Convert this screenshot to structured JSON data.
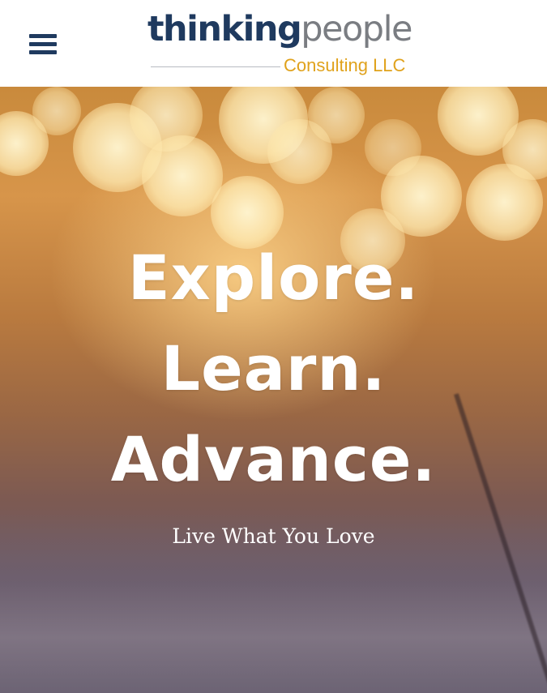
{
  "header": {
    "menu_icon": "hamburger-menu-icon",
    "logo": {
      "word_primary": "thinking",
      "word_secondary": "people",
      "subtitle": "Consulting LLC"
    }
  },
  "hero": {
    "headline": [
      "Explore.",
      "Learn.",
      "Advance."
    ],
    "tagline": "Live What You Love"
  },
  "colors": {
    "brand_navy": "#1f3a5f",
    "brand_gray": "#7a7d82",
    "brand_gold": "#e0a21c"
  }
}
